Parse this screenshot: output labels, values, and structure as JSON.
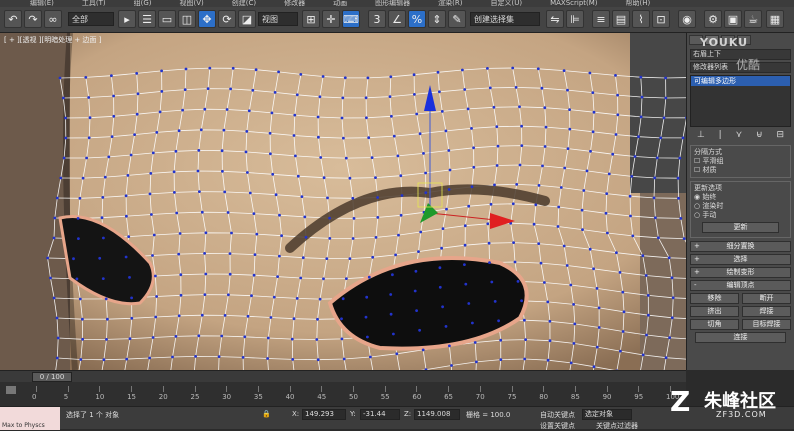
{
  "menubar": {
    "items": [
      "编辑(E)",
      "工具(T)",
      "组(G)",
      "视图(V)",
      "创建(C)",
      "修改器",
      "动画",
      "图形编辑器",
      "渲染(R)",
      "自定义(U)",
      "MAXScript(M)",
      "帮助(H)"
    ]
  },
  "toolbar": {
    "selection_filter": "全部",
    "ref_coord": "视图",
    "named_selection": "创建选择集"
  },
  "viewport": {
    "label": "[ + ][透视 ][明暗处理 + 边面 ]"
  },
  "command_panel": {
    "object_name": "右眉上下",
    "modifier_list": "修改器列表",
    "stack_item": "可编辑多边形",
    "isoline_group": "分隔方式",
    "smooth_result": "平滑组",
    "material": "材质",
    "update_group": "更新选项",
    "always": "始终",
    "render_time": "渲染时",
    "manual": "手动",
    "update_btn": "更新",
    "rollouts": [
      "细分置换",
      "选择",
      "绘制变形",
      "编辑顶点"
    ],
    "remove_btn": "移除",
    "break_btn": "断开",
    "extrude_btn": "挤出",
    "weld_btn": "焊接",
    "chamfer_btn": "切角",
    "target_weld_btn": "目标焊接",
    "connect_btn": "连接"
  },
  "watermark": {
    "logo": "YOUKU",
    "logo_sub": "优酷",
    "site_cn": "朱峰社区",
    "site_url": "ZF3D.COM"
  },
  "timeline": {
    "frame": "0 / 100",
    "ticks": [
      "0",
      "5",
      "10",
      "15",
      "20",
      "25",
      "30",
      "35",
      "40",
      "45",
      "50",
      "55",
      "60",
      "65",
      "70",
      "75",
      "80",
      "85",
      "90",
      "95",
      "100"
    ]
  },
  "status": {
    "selected": "选择了 1 个 对象",
    "script_label": "Max to Physcs",
    "x_label": "X:",
    "x_value": "149.293",
    "y_label": "Y:",
    "y_value": "-31.44",
    "z_label": "Z:",
    "z_value": "1149.008",
    "grid": "栅格 = 100.0",
    "auto_key": "自动关键点",
    "selected_object": "选定对象",
    "set_key": "设置关键点",
    "key_filter": "关键点过滤器"
  }
}
